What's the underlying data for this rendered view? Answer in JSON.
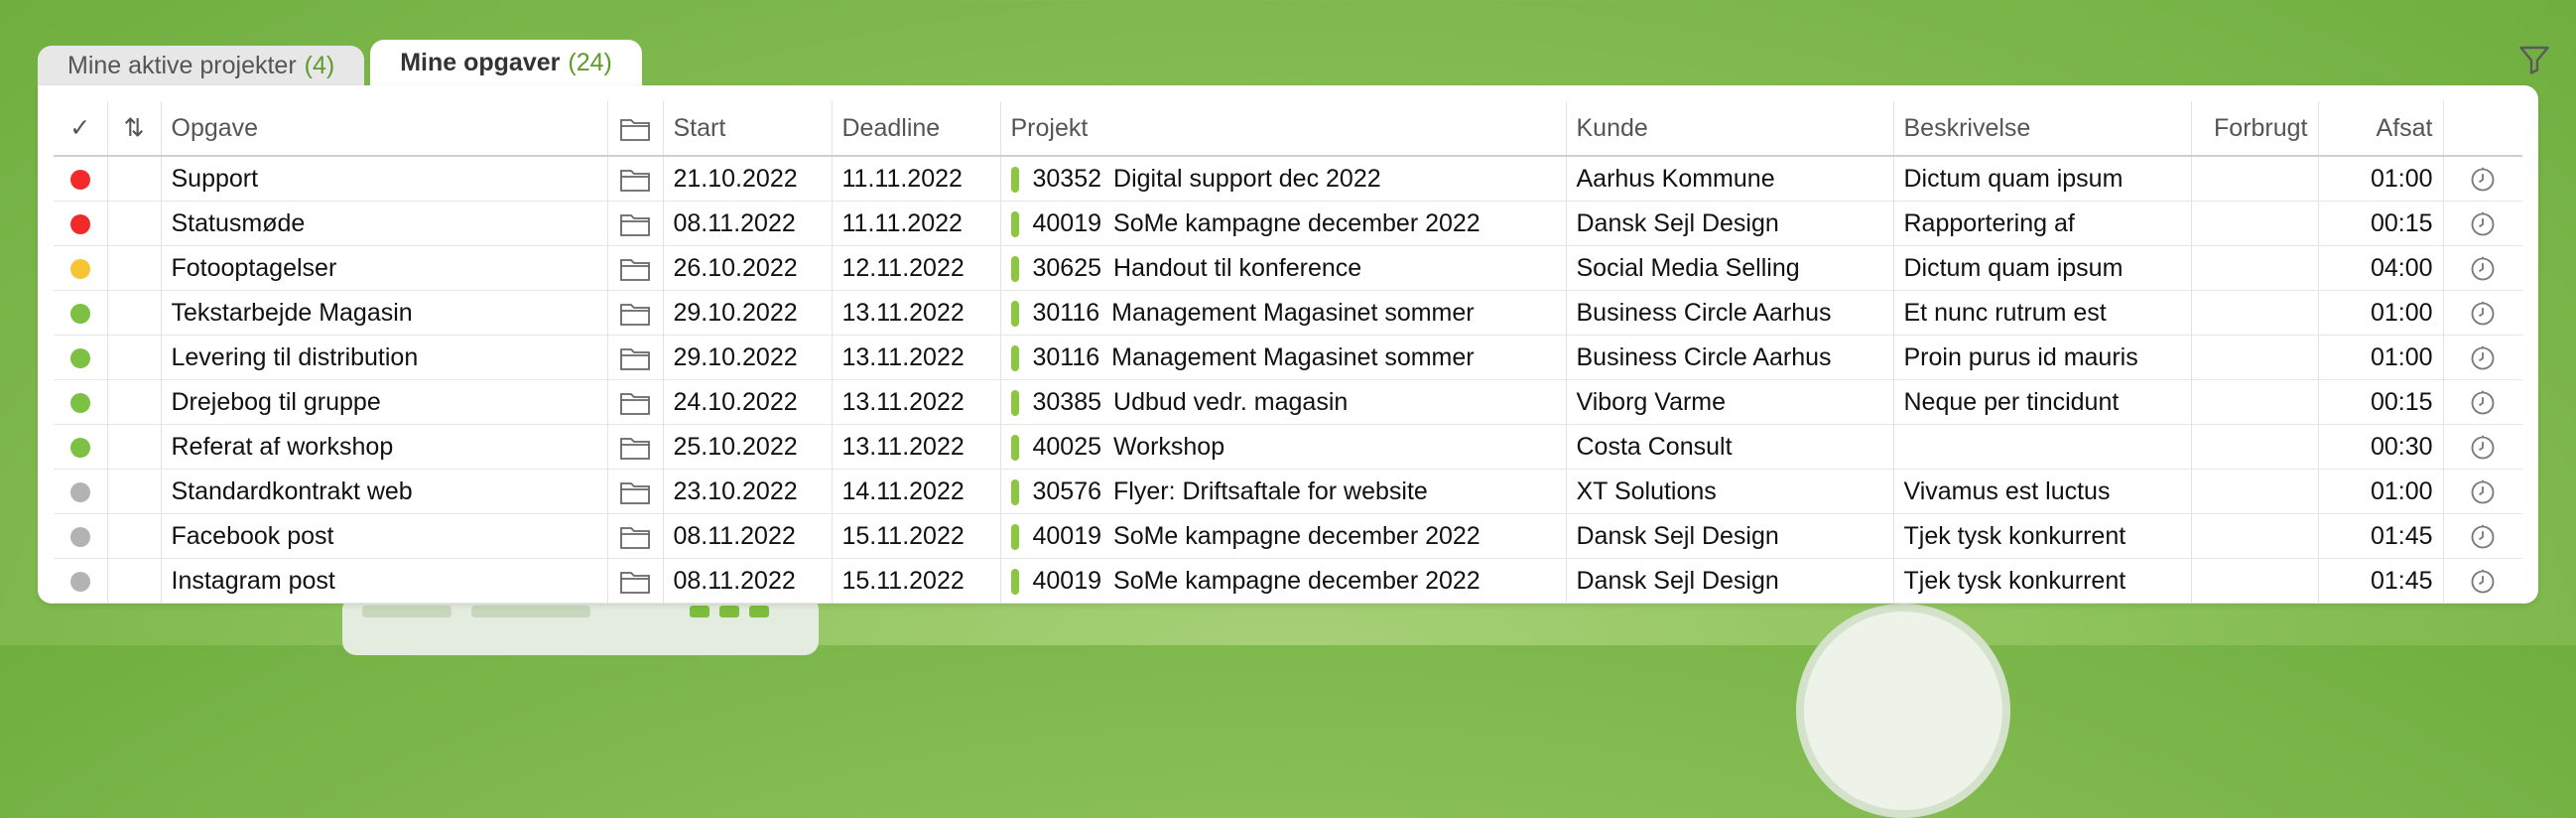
{
  "tabs": [
    {
      "label": "Mine aktive projekter",
      "count": "(4)",
      "active": false
    },
    {
      "label": "Mine opgaver",
      "count": "(24)",
      "active": true
    }
  ],
  "columns": {
    "check": "✓",
    "sort": "⇅",
    "task": "Opgave",
    "start": "Start",
    "deadline": "Deadline",
    "project": "Projekt",
    "customer": "Kunde",
    "description": "Beskrivelse",
    "used": "Forbrugt",
    "allocated": "Afsat"
  },
  "status_colors": {
    "red": "#f22a2a",
    "yellow": "#f7c531",
    "green": "#7cc143",
    "grey": "#b3b3b3"
  },
  "icons": {
    "filter": "filter-icon",
    "folder": "folder-icon",
    "timer": "timer-icon"
  },
  "rows": [
    {
      "status": "red",
      "task": "Support",
      "start": "21.10.2022",
      "deadline": "11.11.2022",
      "project_no": "30352",
      "project_name": "Digital support dec 2022",
      "customer": "Aarhus Kommune",
      "description": "Dictum quam ipsum",
      "used": "",
      "allocated": "01:00"
    },
    {
      "status": "red",
      "task": "Statusmøde",
      "start": "08.11.2022",
      "deadline": "11.11.2022",
      "project_no": "40019",
      "project_name": "SoMe kampagne december 2022",
      "customer": "Dansk Sejl Design",
      "description": "Rapportering af",
      "used": "",
      "allocated": "00:15"
    },
    {
      "status": "yellow",
      "task": "Fotooptagelser",
      "start": "26.10.2022",
      "deadline": "12.11.2022",
      "project_no": "30625",
      "project_name": "Handout til konference",
      "customer": "Social Media Selling",
      "description": "Dictum quam ipsum",
      "used": "",
      "allocated": "04:00"
    },
    {
      "status": "green",
      "task": "Tekstarbejde Magasin",
      "start": "29.10.2022",
      "deadline": "13.11.2022",
      "project_no": "30116",
      "project_name": "Management Magasinet sommer",
      "customer": "Business Circle Aarhus",
      "description": "Et nunc rutrum est",
      "used": "",
      "allocated": "01:00"
    },
    {
      "status": "green",
      "task": "Levering til distribution",
      "start": "29.10.2022",
      "deadline": "13.11.2022",
      "project_no": "30116",
      "project_name": "Management Magasinet sommer",
      "customer": "Business Circle Aarhus",
      "description": "Proin purus id mauris",
      "used": "",
      "allocated": "01:00"
    },
    {
      "status": "green",
      "task": "Drejebog til gruppe",
      "start": "24.10.2022",
      "deadline": "13.11.2022",
      "project_no": "30385",
      "project_name": "Udbud vedr. magasin",
      "customer": "Viborg Varme",
      "description": "Neque per tincidunt",
      "used": "",
      "allocated": "00:15"
    },
    {
      "status": "green",
      "task": "Referat af workshop",
      "start": "25.10.2022",
      "deadline": "13.11.2022",
      "project_no": "40025",
      "project_name": "Workshop",
      "customer": "Costa Consult",
      "description": "",
      "used": "",
      "allocated": "00:30"
    },
    {
      "status": "grey",
      "task": "Standardkontrakt web",
      "start": "23.10.2022",
      "deadline": "14.11.2022",
      "project_no": "30576",
      "project_name": "Flyer: Driftsaftale for website",
      "customer": "XT Solutions",
      "description": "Vivamus est luctus",
      "used": "",
      "allocated": "01:00"
    },
    {
      "status": "grey",
      "task": "Facebook post",
      "start": "08.11.2022",
      "deadline": "15.11.2022",
      "project_no": "40019",
      "project_name": "SoMe kampagne december 2022",
      "customer": "Dansk Sejl Design",
      "description": "Tjek tysk konkurrent",
      "used": "",
      "allocated": "01:45"
    },
    {
      "status": "grey",
      "task": "Instagram post",
      "start": "08.11.2022",
      "deadline": "15.11.2022",
      "project_no": "40019",
      "project_name": "SoMe kampagne december 2022",
      "customer": "Dansk Sejl Design",
      "description": "Tjek tysk konkurrent",
      "used": "",
      "allocated": "01:45"
    }
  ]
}
